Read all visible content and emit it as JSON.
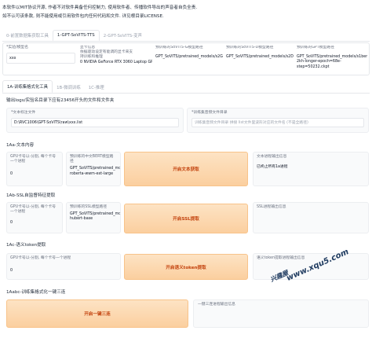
{
  "notice": {
    "line1": "本软件以MIT协议开源, 作者不对软件具备任何控制力, 使用软件者、传播软件导出的声音者自负全责.",
    "line2": "如不认可该条款, 则不能使用或引用软件包内任何代码和文件. 详见根目录LICENSE."
  },
  "main_tabs": [
    {
      "label": "0-前置数据集获取工具"
    },
    {
      "label": "1-GPT-SoVITS-TTS"
    },
    {
      "label": "2-GPT-SoVITS-变声"
    }
  ],
  "top_row": {
    "exp_name_label": "*实验/模型名",
    "exp_name_value": "xxx",
    "gpu_label": "显卡信息",
    "gpu_value": "0    NVIDIA GeForce RTX 3060 Laptop GPU    6 GB",
    "gpu_desc_line1": "依据驱动设定有能调的显卡来支",
    "gpu_desc_line2": "持训练和推理",
    "sovits_g_label": "预训练的SoVITS-G模型路径",
    "sovits_g_value": "GPT_SoVITS/pretrained_models/s2G488k.pth",
    "sovits_d_label": "预训练的SoVITS-D模型路径",
    "sovits_d_value": "GPT_SoVITS/pretrained_models/s2D488k.pth",
    "gpt_label": "预训练的GPT模型路径",
    "gpt_value": "GPT_SoVITS/pretrained_models/s1bert25hz-2kh-longer-epoch=68e-step=50232.ckpt"
  },
  "sub_tabs": [
    {
      "label": "1A-训练集格式化工具"
    },
    {
      "label": "1B-微调训练"
    },
    {
      "label": "1C-推理"
    }
  ],
  "output_note": "输出logs/实验名目录下应有23456开头的文件和文件夹",
  "text_label_file": {
    "label": "*文本标注文件",
    "value": "D:\\RVC1006\\GPT-SoVITS\\raw\\xxx.list"
  },
  "wav_dir": {
    "label": "*训练集音频文件目录",
    "placeholder": "训练集音频文件目录 拼接 list文件里波形对应的文件名 (不是全路径)"
  },
  "sec_1aa": {
    "title": "1Aa-文本内容",
    "gpu_label": "GPU卡号以-分割, 每个卡号一个进程",
    "gpu_value": "0",
    "bert_label": "预训练的中文BERT模型路径",
    "bert_value": "GPT_SoVITS/pretrained_models/chinese-roberta-wwm-ext-large",
    "button": "开启文本获取",
    "info_label": "文本进程输出信息",
    "info_value": "已终止所有1a进程"
  },
  "sec_1ab": {
    "title": "1Ab-SSL自监督特征提取",
    "gpu_label": "GPU卡号以-分割, 每个卡号一个进程",
    "gpu_value": "0",
    "ssl_label": "预训练的SSL模型路径",
    "ssl_value": "GPT_SoVITS/pretrained_models/chinese-hubert-base",
    "button": "开启SSL提取",
    "info_label": "SSL进程输出信息",
    "info_value": ""
  },
  "sec_1ac": {
    "title": "1Ac-语义token提取",
    "gpu_label": "GPU卡号以-分割, 每个卡号一个进程",
    "gpu_value": "0",
    "button": "开启语义token提取",
    "info_label": "语义token提取进程输出信息",
    "info_value": ""
  },
  "sec_1abc": {
    "title": "1Aabc-训练集格式化一键三连",
    "button": "开启一键三连",
    "info_label": "一键三连进程输出信息",
    "info_value": ""
  },
  "watermark": {
    "site": "www.xqu5.com",
    "brand": "兴趣屋"
  },
  "colors": {
    "accent_orange": "#fbcf9f",
    "button_text": "#c2410c",
    "border": "#e5e7eb"
  }
}
